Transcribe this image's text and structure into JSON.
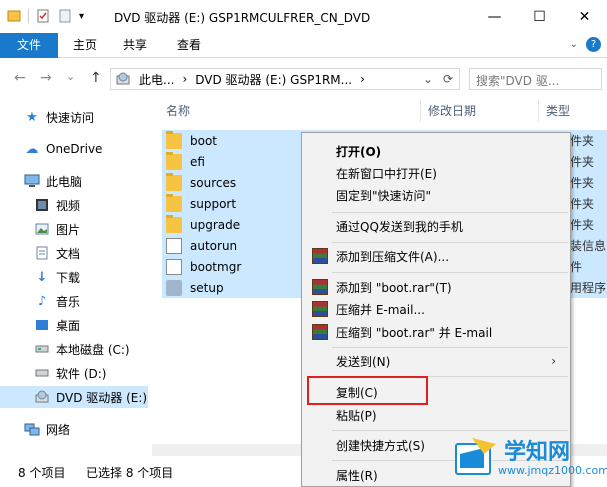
{
  "window": {
    "title": "DVD 驱动器 (E:) GSP1RMCULFRER_CN_DVD",
    "minimize": "—",
    "maximize": "☐",
    "close": "✕"
  },
  "ribbon": {
    "tabs": [
      "文件",
      "主页",
      "共享",
      "查看"
    ],
    "help": "?"
  },
  "address": {
    "back": "←",
    "forward": "→",
    "recent": "⌄",
    "up": "↑",
    "segments": [
      "此电...",
      "›",
      "DVD 驱动器 (E:) GSP1RM...",
      "›"
    ],
    "dropdown": "⌄",
    "refresh": "⟳",
    "search_placeholder": "搜索\"DVD 驱..."
  },
  "nav": {
    "items": [
      {
        "label": "快速访问",
        "icon": "star-icon"
      },
      {
        "label": "OneDrive",
        "icon": "cloud-icon"
      },
      {
        "label": "此电脑",
        "icon": "computer-icon"
      },
      {
        "label": "视频",
        "icon": "video-icon"
      },
      {
        "label": "图片",
        "icon": "picture-icon"
      },
      {
        "label": "文档",
        "icon": "document-icon"
      },
      {
        "label": "下载",
        "icon": "download-icon"
      },
      {
        "label": "音乐",
        "icon": "music-icon"
      },
      {
        "label": "桌面",
        "icon": "desktop-icon"
      },
      {
        "label": "本地磁盘 (C:)",
        "icon": "drive-icon"
      },
      {
        "label": "软件 (D:)",
        "icon": "drive-icon"
      },
      {
        "label": "DVD 驱动器 (E:)",
        "icon": "dvd-icon"
      },
      {
        "label": "网络",
        "icon": "network-icon"
      }
    ]
  },
  "filelist": {
    "columns": [
      "名称",
      "修改日期",
      "类型"
    ],
    "rows": [
      {
        "name": "boot",
        "type": "件夹",
        "kind": "folder"
      },
      {
        "name": "efi",
        "type": "件夹",
        "kind": "folder"
      },
      {
        "name": "sources",
        "type": "件夹",
        "kind": "folder"
      },
      {
        "name": "support",
        "type": "件夹",
        "kind": "folder"
      },
      {
        "name": "upgrade",
        "type": "件夹",
        "kind": "folder"
      },
      {
        "name": "autorun",
        "type": "装信息",
        "kind": "file"
      },
      {
        "name": "bootmgr",
        "type": "件",
        "kind": "file"
      },
      {
        "name": "setup",
        "type": "用程序",
        "kind": "setup"
      }
    ]
  },
  "status": {
    "count": "8 个项目",
    "selected": "已选择 8 个项目"
  },
  "context_menu": {
    "open": "打开(O)",
    "open_new": "在新窗口中打开(E)",
    "pin_quick": "固定到\"快速访问\"",
    "qq_send": "通过QQ发送到我的手机",
    "add_archive": "添加到压缩文件(A)...",
    "add_boot_rar": "添加到 \"boot.rar\"(T)",
    "compress_email": "压缩并 E-mail...",
    "compress_boot_email": "压缩到 \"boot.rar\" 并 E-mail",
    "send_to": "发送到(N)",
    "submenu_arrow": "›",
    "copy": "复制(C)",
    "paste": "粘贴(P)",
    "create_shortcut": "创建快捷方式(S)",
    "properties": "属性(R)"
  },
  "watermark": {
    "big": "学知网",
    "small": "www.jmqz1000.com"
  },
  "colors": {
    "file_tab": "#1979ca",
    "selection": "#cce8ff",
    "highlight": "#e02020",
    "watermark": "#1a8bd8"
  }
}
